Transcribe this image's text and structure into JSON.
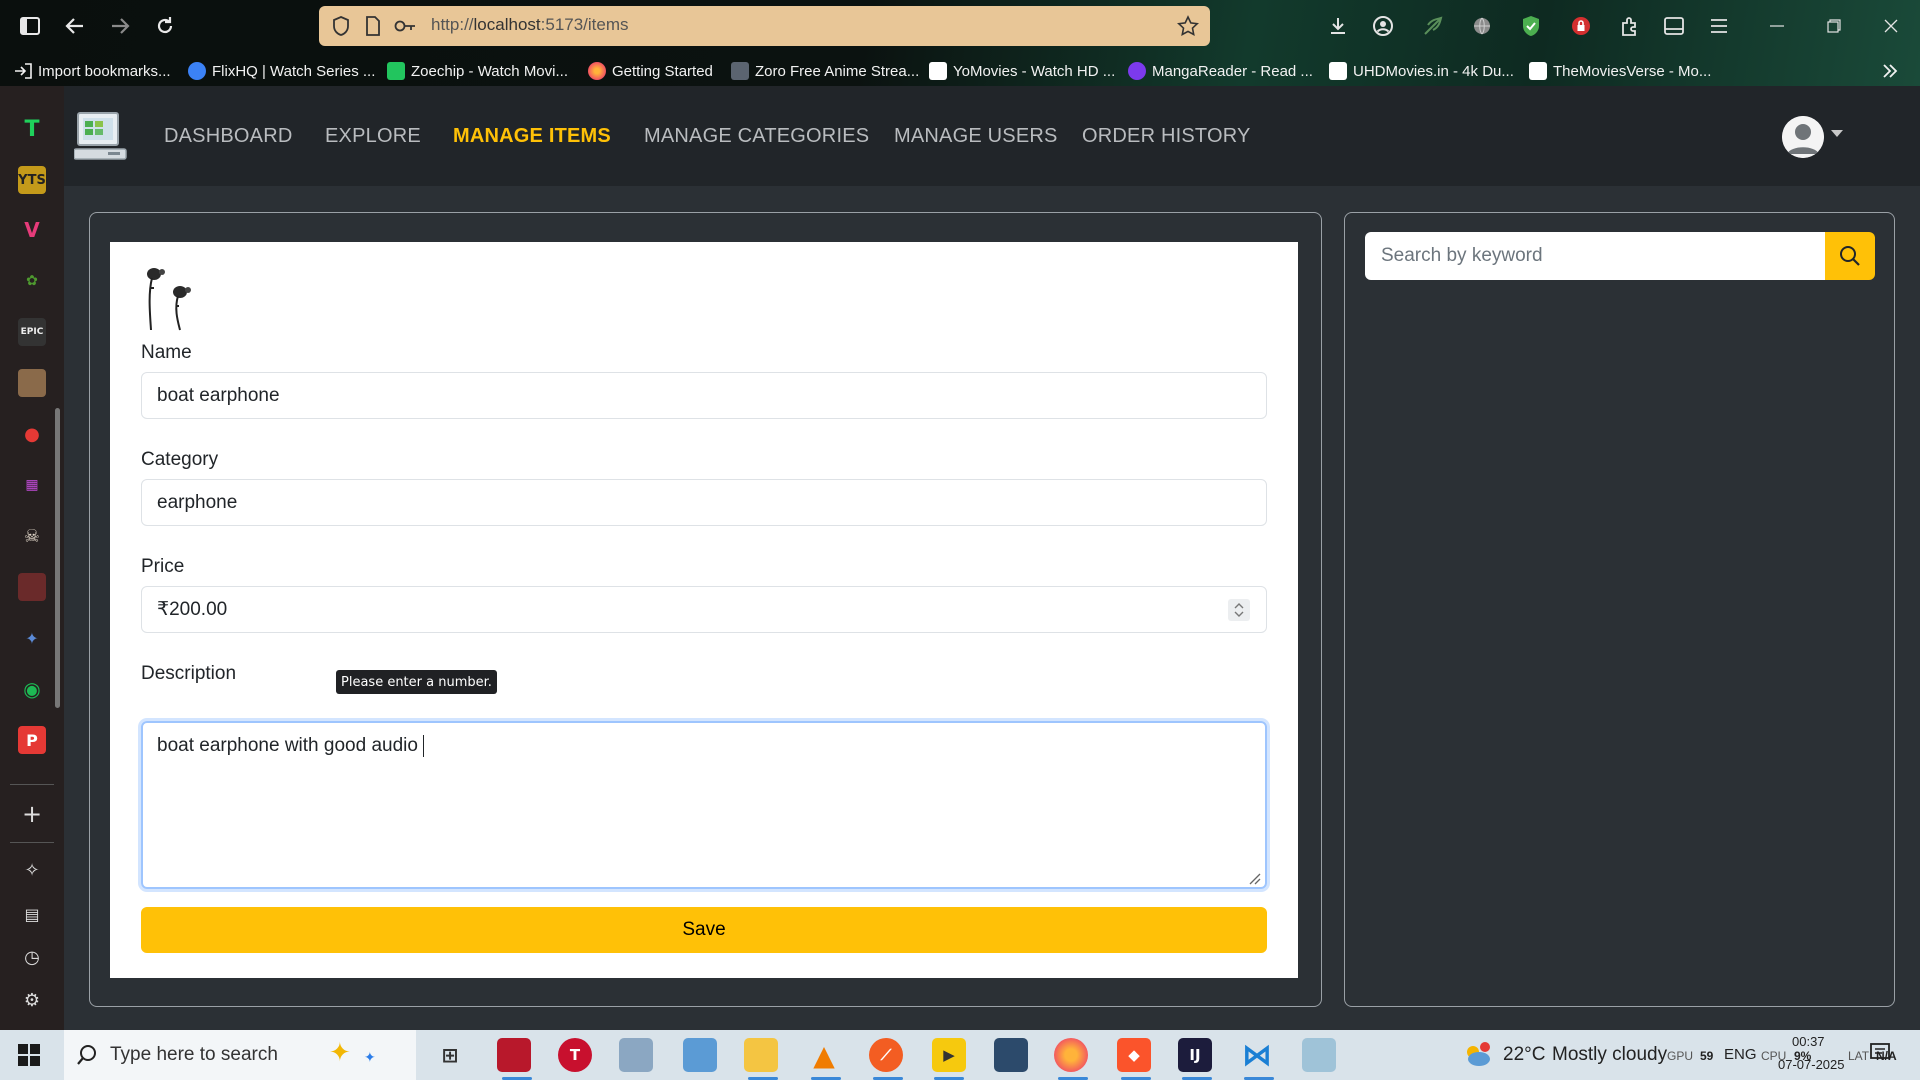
{
  "browser": {
    "url_prefix": "http://",
    "url_host": "localhost",
    "url_path": ":5173/items",
    "bookmarks": [
      {
        "label": "Import bookmarks...",
        "color": "#ffffff"
      },
      {
        "label": "FlixHQ | Watch Series ...",
        "color": "#3b82f6"
      },
      {
        "label": "Zoechip - Watch Movi...",
        "color": "#22c55e"
      },
      {
        "label": "Getting Started",
        "color": "#ef6c2f"
      },
      {
        "label": "Zoro Free Anime Strea...",
        "color": "#d1d5db"
      },
      {
        "label": "YoMovies - Watch HD ...",
        "color": "#ffffff"
      },
      {
        "label": "MangaReader - Read ...",
        "color": "#7c3aed"
      },
      {
        "label": "UHDMovies.in - 4k Du...",
        "color": "#ffffff"
      },
      {
        "label": "TheMoviesVerse - Mo...",
        "color": "#ffffff"
      }
    ]
  },
  "nav": {
    "links": [
      "DASHBOARD",
      "EXPLORE",
      "MANAGE ITEMS",
      "MANAGE CATEGORIES",
      "MANAGE USERS",
      "ORDER HISTORY"
    ],
    "active": "MANAGE ITEMS",
    "accent": "#ffc107"
  },
  "form": {
    "name_label": "Name",
    "name_value": "boat earphone",
    "category_label": "Category",
    "category_value": "earphone",
    "price_label": "Price",
    "price_value": "₹200.00",
    "description_label": "Description",
    "description_value": "boat earphone with good audio ",
    "tooltip": "Please enter a number.",
    "save_label": "Save"
  },
  "search": {
    "placeholder": "Search by keyword"
  },
  "taskbar": {
    "search_placeholder": "Type here to search",
    "weather_temp": "22°C",
    "weather_desc": "Mostly cloudy",
    "gpu_label": "GPU",
    "gpu_value": "59",
    "lang": "ENG",
    "cpu_label": "CPU",
    "cpu_value": "9%",
    "lat_label": "LAT",
    "lat_value": "N/A",
    "time": "00:37",
    "date": "07-07-2025"
  }
}
